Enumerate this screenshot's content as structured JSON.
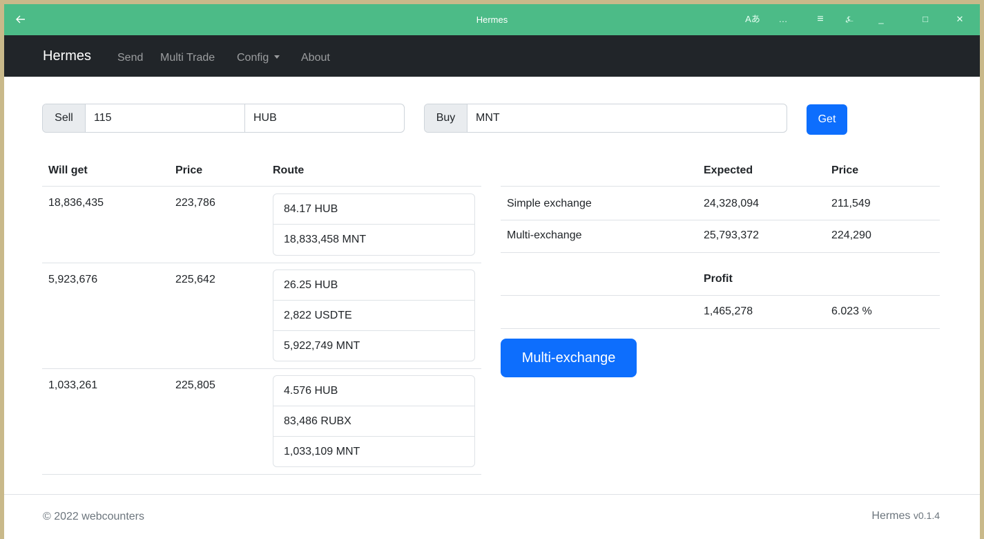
{
  "window": {
    "title": "Hermes",
    "controls": {
      "translate": "Aあ",
      "more": "…",
      "menu": "≡",
      "pin": "⍼",
      "minimize": "_",
      "maximize": "□",
      "close": "✕"
    }
  },
  "navbar": {
    "brand": "Hermes",
    "links": {
      "send": "Send",
      "multi_trade": "Multi Trade",
      "config": "Config",
      "about": "About"
    }
  },
  "form": {
    "sell_label": "Sell",
    "sell_amount": "115",
    "sell_coin": "HUB",
    "buy_label": "Buy",
    "buy_coin": "MNT",
    "get_button": "Get"
  },
  "routes_table": {
    "headers": {
      "will_get": "Will get",
      "price": "Price",
      "route": "Route"
    },
    "rows": [
      {
        "will_get": "18,836,435",
        "price": "223,786",
        "route": [
          "84.17 HUB",
          "18,833,458 MNT"
        ]
      },
      {
        "will_get": "5,923,676",
        "price": "225,642",
        "route": [
          "26.25 HUB",
          "2,822 USDTE",
          "5,922,749 MNT"
        ]
      },
      {
        "will_get": "1,033,261",
        "price": "225,805",
        "route": [
          "4.576 HUB",
          "83,486 RUBX",
          "1,033,109 MNT"
        ]
      }
    ]
  },
  "summary_table": {
    "headers": {
      "expected": "Expected",
      "price": "Price"
    },
    "rows": [
      {
        "label": "Simple exchange",
        "expected": "24,328,094",
        "price": "211,549"
      },
      {
        "label": "Multi-exchange",
        "expected": "25,793,372",
        "price": "224,290"
      }
    ],
    "profit_header": "Profit",
    "profit_value": "1,465,278",
    "profit_percent": "6.023 %"
  },
  "multi_exchange_button": "Multi-exchange",
  "footer": {
    "copyright": "© 2022 webcounters",
    "app_name": "Hermes",
    "version": "v0.1.4"
  }
}
